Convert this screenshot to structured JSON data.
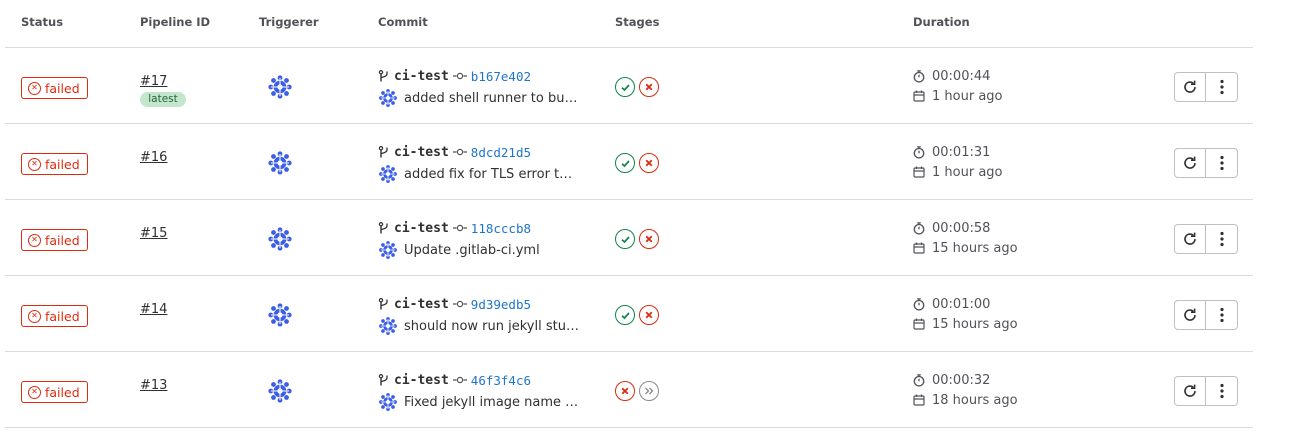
{
  "headers": {
    "status": "Status",
    "pipeline_id": "Pipeline ID",
    "triggerer": "Triggerer",
    "commit": "Commit",
    "stages": "Stages",
    "duration": "Duration"
  },
  "colors": {
    "failed": "#dd2b0e",
    "success": "#108548",
    "skipped": "#89888d",
    "link": "#1f75cb",
    "latest_bg": "#c3e6cd",
    "avatar": "#3c5de8"
  },
  "rows": [
    {
      "status": "failed",
      "id": "#17",
      "badge": "latest",
      "branch": "ci-test",
      "sha": "b167e402",
      "message": "added shell runner to buil…",
      "stages": [
        "success",
        "failed"
      ],
      "duration": "00:00:44",
      "finished": "1 hour ago"
    },
    {
      "status": "failed",
      "id": "#16",
      "badge": "",
      "branch": "ci-test",
      "sha": "8dcd21d5",
      "message": "added fix for TLS error to c…",
      "stages": [
        "success",
        "failed"
      ],
      "duration": "00:01:31",
      "finished": "1 hour ago"
    },
    {
      "status": "failed",
      "id": "#15",
      "badge": "",
      "branch": "ci-test",
      "sha": "118cccb8",
      "message": "Update .gitlab-ci.yml",
      "stages": [
        "success",
        "failed"
      ],
      "duration": "00:00:58",
      "finished": "15 hours ago"
    },
    {
      "status": "failed",
      "id": "#14",
      "badge": "",
      "branch": "ci-test",
      "sha": "9d39edb5",
      "message": "should now run jekyll stuff…",
      "stages": [
        "success",
        "failed"
      ],
      "duration": "00:01:00",
      "finished": "15 hours ago"
    },
    {
      "status": "failed",
      "id": "#13",
      "badge": "",
      "branch": "ci-test",
      "sha": "46f3f4c6",
      "message": "Fixed jekyll image name in…",
      "stages": [
        "failed",
        "skipped"
      ],
      "duration": "00:00:32",
      "finished": "18 hours ago"
    }
  ],
  "icons": {
    "status_failed": "x-circle-icon",
    "branch": "branch-icon",
    "commit": "commit-icon",
    "stage_success": "check-circle-icon",
    "stage_failed": "x-circle-icon",
    "stage_skipped": "skipped-chevrons-icon",
    "duration": "stopwatch-icon",
    "finished": "calendar-icon",
    "retry": "retry-icon",
    "more": "kebab-menu-icon"
  }
}
